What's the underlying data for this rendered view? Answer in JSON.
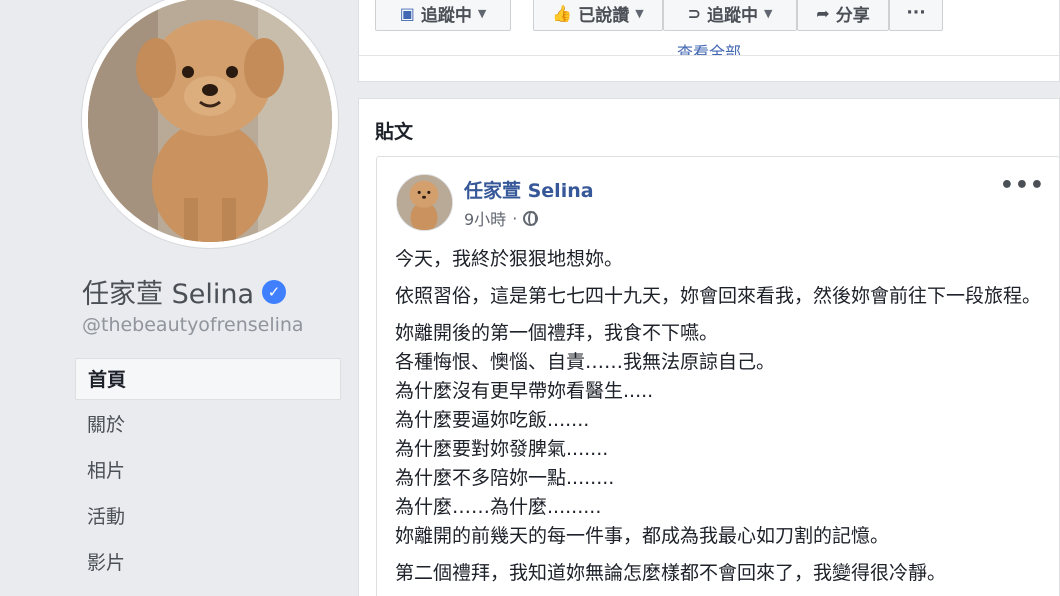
{
  "profile": {
    "name": "任家萱 Selina",
    "handle": "@thebeautyofrenselina",
    "verified_mark": "✓"
  },
  "nav": {
    "items": [
      {
        "label": "首頁",
        "active": true
      },
      {
        "label": "關於",
        "active": false
      },
      {
        "label": "相片",
        "active": false
      },
      {
        "label": "活動",
        "active": false
      },
      {
        "label": "影片",
        "active": false
      }
    ]
  },
  "actions": {
    "follow_left": "追蹤中",
    "liked": "已說讚",
    "follow_right": "追蹤中",
    "share": "分享",
    "more": "···"
  },
  "top_card": {
    "see_all": "查看全部"
  },
  "posts": {
    "heading": "貼文",
    "author": "任家萱 Selina",
    "time": "9小時",
    "separator": "·",
    "more": "•••",
    "paragraph1": "今天，我終於狠狠地想妳。",
    "paragraph2": "依照習俗，這是第七七四十九天，妳會回來看我，然後妳會前往下一段旅程。",
    "lines": [
      "妳離開後的第一個禮拜，我食不下嚥。",
      "各種悔恨、懊惱、自責……我無法原諒自己。",
      "為什麼沒有更早帶妳看醫生.....",
      "為什麼要逼妳吃飯.......",
      "為什麼要對妳發脾氣.......",
      "為什麼不多陪妳一點........",
      "為什麼……為什麼.........",
      "妳離開的前幾天的每一件事，都成為我最心如刀割的記憶。",
      "第二個禮拜，我知道妳無論怎麼樣都不會回來了，我變得很冷靜。"
    ]
  },
  "colors": {
    "background": "#e9ebee",
    "link_blue": "#365899",
    "verified_blue": "#4080ff"
  }
}
